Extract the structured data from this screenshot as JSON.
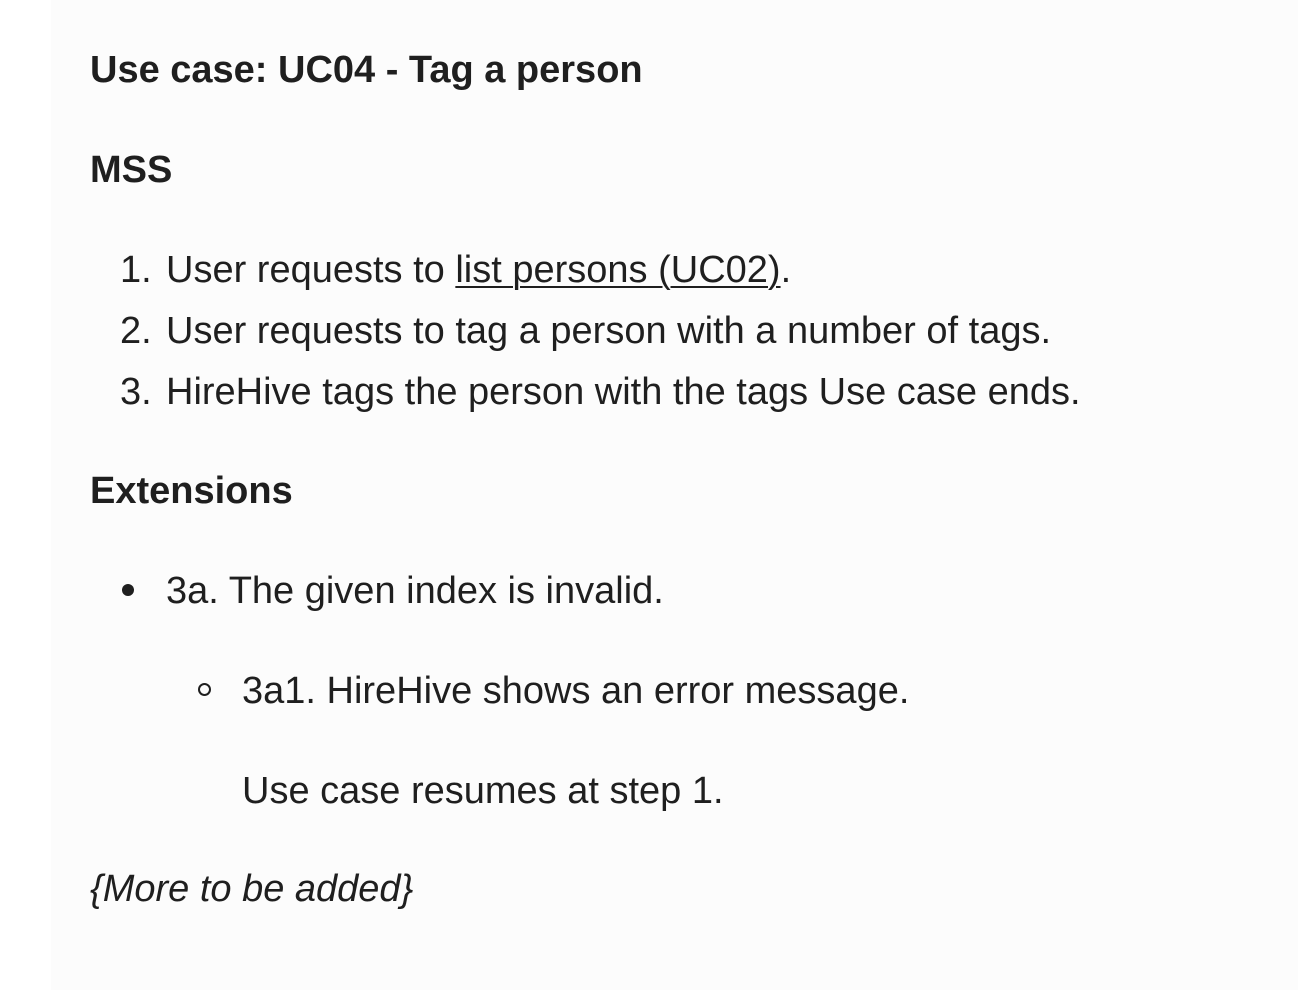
{
  "title": "Use case: UC04 - Tag a person",
  "mss": {
    "heading": "MSS",
    "steps": [
      {
        "number": "1.",
        "text_before": "User requests to ",
        "link_text": "list persons (UC02)",
        "text_after": "."
      },
      {
        "number": "2.",
        "text": "User requests to tag a person with a number of tags."
      },
      {
        "number": "3.",
        "text": "HireHive tags the person with the tags Use case ends."
      }
    ]
  },
  "extensions": {
    "heading": "Extensions",
    "items": [
      {
        "text": "3a. The given index is invalid.",
        "subitems": [
          {
            "text": "3a1. HireHive shows an error message.",
            "note": "Use case resumes at step 1."
          }
        ]
      }
    ]
  },
  "footer_note": "{More to be added}"
}
